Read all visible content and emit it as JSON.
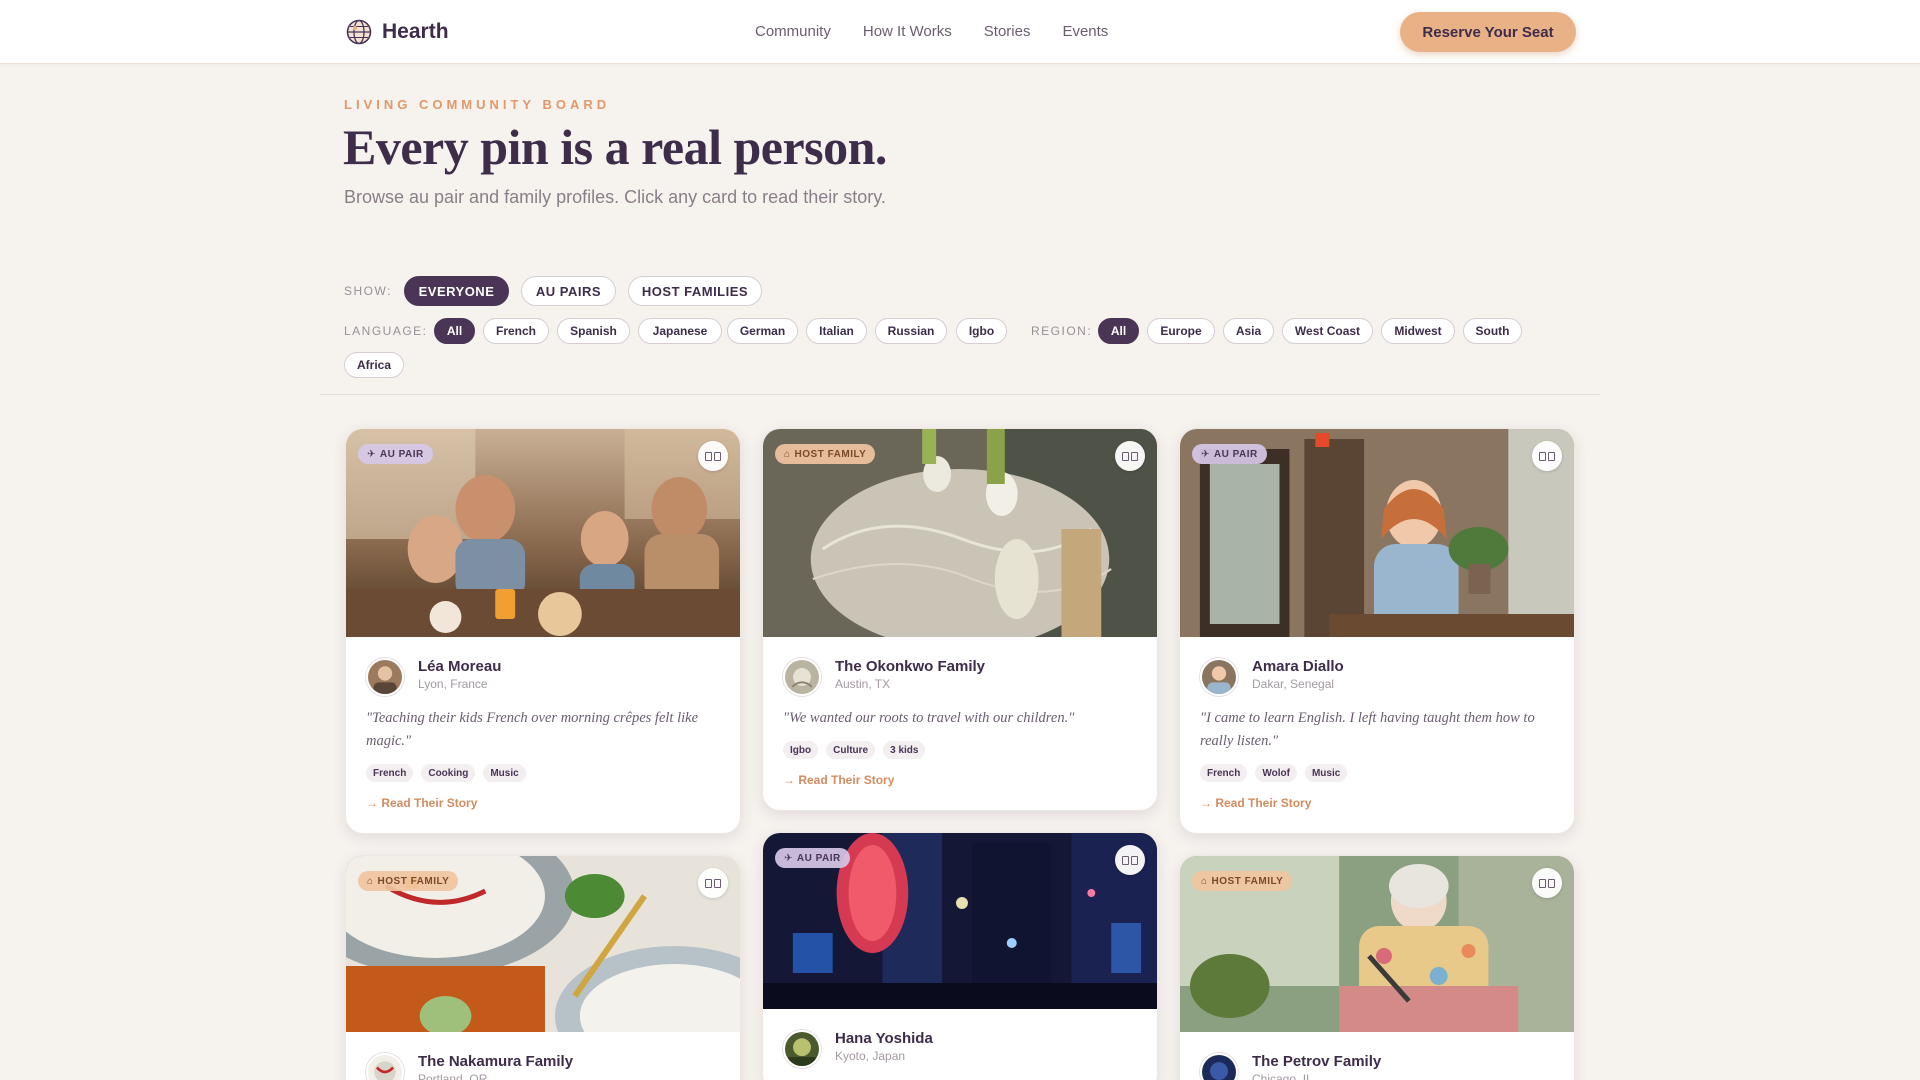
{
  "nav": {
    "brand": "Hearth",
    "links": [
      "Community",
      "How It Works",
      "Stories",
      "Events"
    ],
    "cta": "Reserve Your Seat"
  },
  "hero": {
    "eyebrow": "LIVING COMMUNITY BOARD",
    "title": "Every pin is a real person.",
    "subtitle": "Browse au pair and family profiles. Click any card to read their story."
  },
  "filters": {
    "show_label": "SHOW:",
    "show_options": [
      "EVERYONE",
      "AU PAIRS",
      "HOST FAMILIES"
    ],
    "show_selected": "EVERYONE",
    "language_label": "LANGUAGE:",
    "language_options": [
      "All",
      "French",
      "Spanish",
      "Japanese",
      "German",
      "Italian",
      "Russian",
      "Igbo"
    ],
    "language_selected": "All",
    "region_label": "REGION:",
    "region_options": [
      "All",
      "Europe",
      "Asia",
      "West Coast",
      "Midwest",
      "South",
      "Africa"
    ],
    "region_selected": "All"
  },
  "cards": [
    {
      "badge": "AU PAIR",
      "name": "Léa Moreau",
      "location": "Lyon, France",
      "quote": "\"Teaching their kids French over morning crêpes felt like magic.\"",
      "tags": [
        "French",
        "Cooking",
        "Music"
      ],
      "cta": "Read Their Story"
    },
    {
      "badge": "HOST FAMILY",
      "name": "The Okonkwo Family",
      "location": "Austin, TX",
      "quote": "\"We wanted our roots to travel with our children.\"",
      "tags": [
        "Igbo",
        "Culture",
        "3 kids"
      ],
      "cta": "Read Their Story"
    },
    {
      "badge": "AU PAIR",
      "name": "Amara Diallo",
      "location": "Dakar, Senegal",
      "quote": "\"I came to learn English. I left having taught them how to really listen.\"",
      "tags": [
        "French",
        "Wolof",
        "Music"
      ],
      "cta": "Read Their Story"
    },
    {
      "badge": "HOST FAMILY",
      "name": "The Nakamura Family",
      "location": "Portland, OR"
    },
    {
      "badge": "AU PAIR",
      "name": "Hana Yoshida",
      "location": "Kyoto, Japan"
    },
    {
      "badge": "HOST FAMILY",
      "name": "The Petrov Family",
      "location": "Chicago, IL"
    }
  ],
  "icons": {
    "brand": "globe-logo-icon",
    "badge_aupair": "plane-icon",
    "badge_host": "house-icon",
    "save": "bookmark-icon",
    "read": "arrow-right-icon"
  },
  "colors": {
    "accent": "#e9b186",
    "primary": "#4a3556",
    "link": "#d38b5f",
    "eyebrow": "#e0996a",
    "background": "#f6f2ee"
  }
}
